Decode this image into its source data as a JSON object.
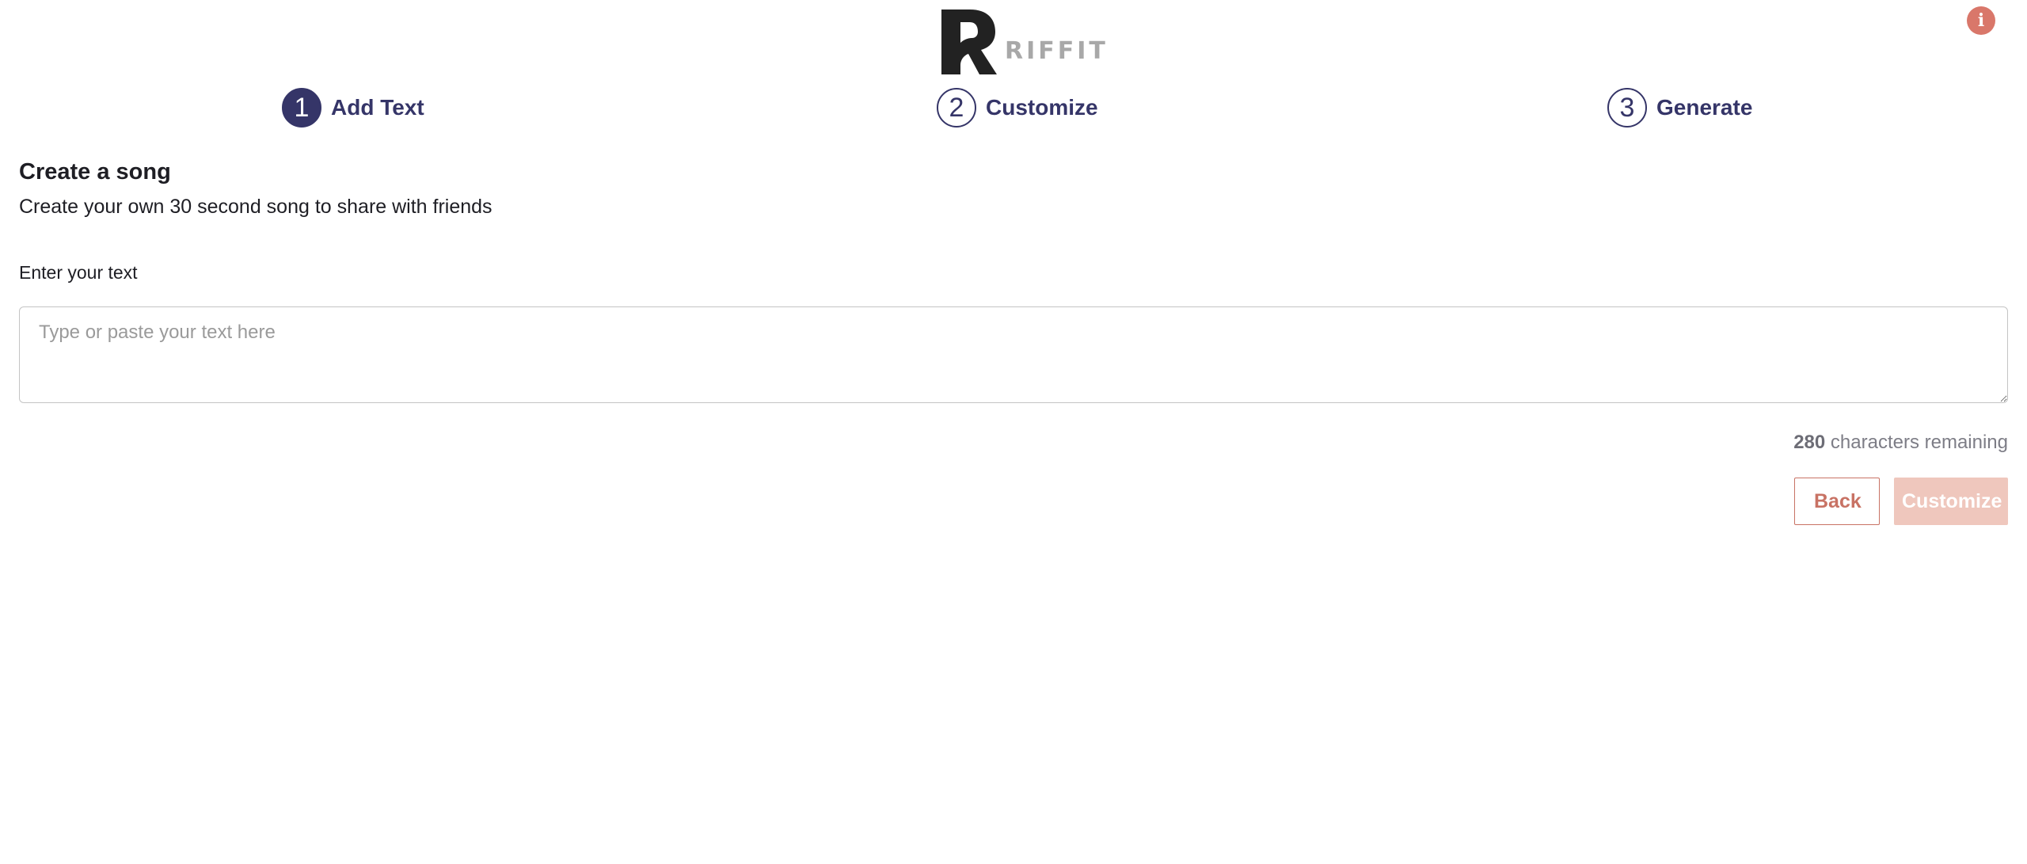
{
  "header": {
    "logo_text": "RIFFIT",
    "info_glyph": "i"
  },
  "stepper": {
    "steps": [
      {
        "number": "1",
        "label": "Add Text",
        "active": true
      },
      {
        "number": "2",
        "label": "Customize",
        "active": false
      },
      {
        "number": "3",
        "label": "Generate",
        "active": false
      }
    ]
  },
  "main": {
    "title": "Create a song",
    "subtitle": "Create your own 30 second song to share with friends",
    "field_label": "Enter your text",
    "textarea_placeholder": "Type or paste your text here",
    "textarea_value": "",
    "counter_value": "280",
    "counter_suffix": " characters remaining"
  },
  "actions": {
    "back_label": "Back",
    "customize_label": "Customize"
  },
  "colors": {
    "brand_navy": "#353568",
    "accent_coral": "#d9776a",
    "button_disabled": "#efc7bd"
  },
  "icons": {
    "logo": "riffit-logo-icon",
    "info": "info-icon"
  }
}
